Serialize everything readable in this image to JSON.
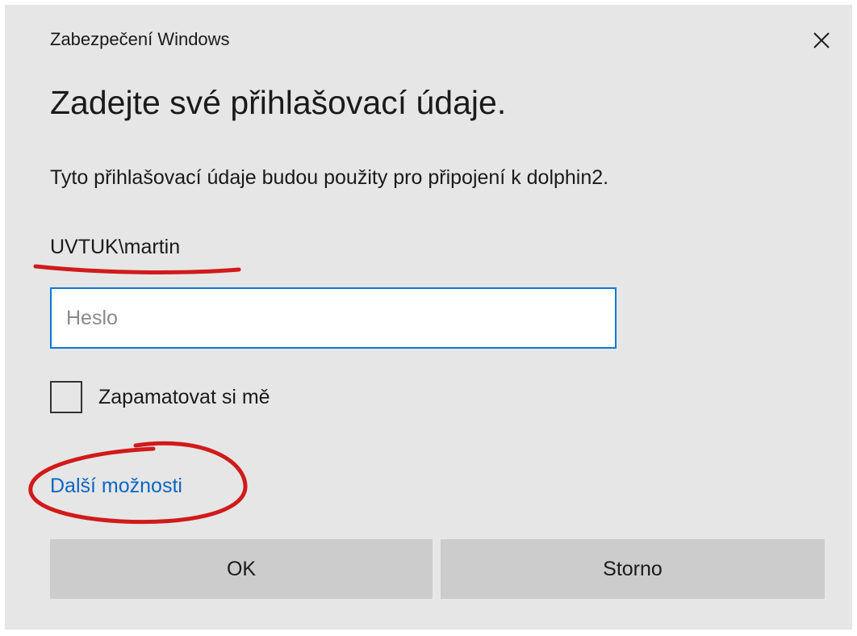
{
  "dialog": {
    "caption": "Zabezpečení Windows",
    "close_icon": "close-icon",
    "heading": "Zadejte své přihlašovací údaje.",
    "description": "Tyto přihlašovací údaje budou použity pro připojení k dolphin2.",
    "username": "UVTUK\\martin",
    "password": {
      "value": "",
      "placeholder": "Heslo"
    },
    "remember": {
      "label": "Zapamatovat si mě",
      "checked": false
    },
    "more_options_label": "Další možnosti",
    "ok_label": "OK",
    "cancel_label": "Storno"
  },
  "colors": {
    "dialog_background": "#e6e6e6",
    "input_border_focus": "#0a78d4",
    "link": "#0a66c2",
    "button_background": "#cccccc",
    "annotation_red": "#d11a1a"
  }
}
